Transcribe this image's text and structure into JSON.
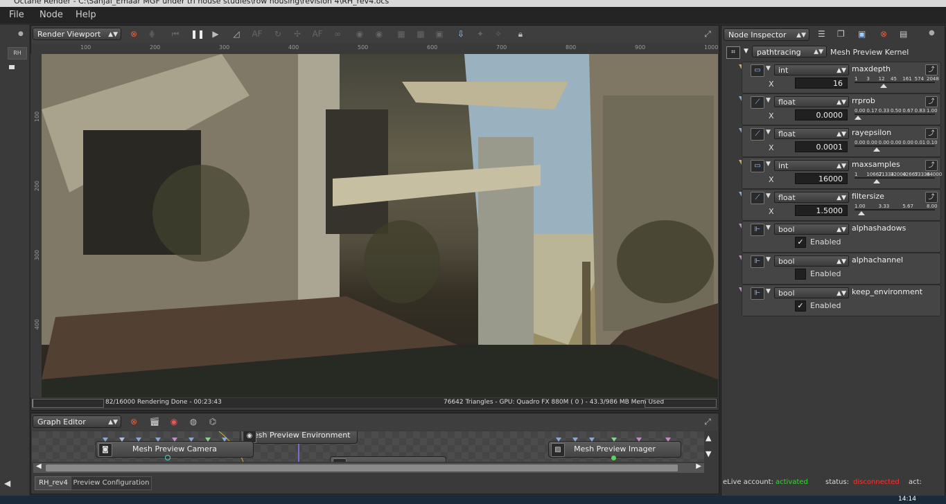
{
  "window": {
    "title": "Octane Render - C:\\Sanjal_Emaar MGF under tri house studies\\row housing\\revision 4\\RH_rev4.ocs"
  },
  "menu": [
    "File",
    "Node",
    "Help"
  ],
  "viewport": {
    "mode_label": "Render Viewport",
    "ruler_h": [
      "100",
      "200",
      "300",
      "400",
      "500",
      "600",
      "700",
      "800",
      "900",
      "1000"
    ],
    "ruler_v": [
      "100",
      "200",
      "300",
      "400"
    ],
    "status_left": "82/16000 Rendering Done - 00:23:43",
    "status_right": "76642 Triangles - GPU: Quadro FX 880M ( 0 ) - 43.3/986 MB Mem Used",
    "progress_fraction": 0.005
  },
  "left_tab": "RH",
  "graph": {
    "mode_label": "Graph Editor",
    "nodes": {
      "environment": "Mesh Preview Environment",
      "camera": "Mesh Preview Camera",
      "imager": "Mesh Preview Imager"
    },
    "tabs": [
      "RH_rev4",
      "Preview Configuration"
    ]
  },
  "inspector": {
    "mode_label": "Node Inspector",
    "kernel_type": "pathtracing",
    "kernel_name": "Mesh Preview Kernel",
    "params": [
      {
        "type": "int",
        "name": "maxdepth",
        "x": "16",
        "ticks": [
          "1",
          "3",
          "12",
          "45",
          "161",
          "574",
          "2048"
        ],
        "thumb": 0.35,
        "kind": "int"
      },
      {
        "type": "float",
        "name": "rrprob",
        "x": "0.0000",
        "ticks": [
          "0.00",
          "0.17",
          "0.33",
          "0.50",
          "0.67",
          "0.83",
          "1.00"
        ],
        "thumb": 0.0,
        "kind": "float"
      },
      {
        "type": "float",
        "name": "rayepsilon",
        "x": "0.0001",
        "ticks": [
          "0.00",
          "0.00",
          "0.00",
          "0.00",
          "0.00",
          "0.01",
          "0.10"
        ],
        "thumb": 0.25,
        "kind": "float"
      },
      {
        "type": "int",
        "name": "maxsamples",
        "x": "16000",
        "ticks": [
          "1",
          "10667",
          "21334",
          "32000",
          "42667",
          "53334",
          "64000"
        ],
        "thumb": 0.25,
        "kind": "int"
      },
      {
        "type": "float",
        "name": "filtersize",
        "x": "1.5000",
        "ticks": [
          "1.00",
          "3.33",
          "5.67",
          "8.00"
        ],
        "thumb": 0.05,
        "kind": "float"
      }
    ],
    "bools": [
      {
        "type": "bool",
        "name": "alphashadows",
        "label": "Enabled",
        "checked": true
      },
      {
        "type": "bool",
        "name": "alphachannel",
        "label": "Enabled",
        "checked": false
      },
      {
        "type": "bool",
        "name": "keep_environment",
        "label": "Enabled",
        "checked": true
      }
    ]
  },
  "live": {
    "account_label": "eLive account:",
    "account_value": "activated",
    "status_label": "status:",
    "status_value": "disconnected",
    "act_label": "act:"
  },
  "clock": "14:14",
  "colors": {
    "activated": "#39d439",
    "disconnected": "#ff3030",
    "int_pin": "#d4b040",
    "float_pin": "#8ea8d0",
    "bool_pin": "#c090c0"
  }
}
